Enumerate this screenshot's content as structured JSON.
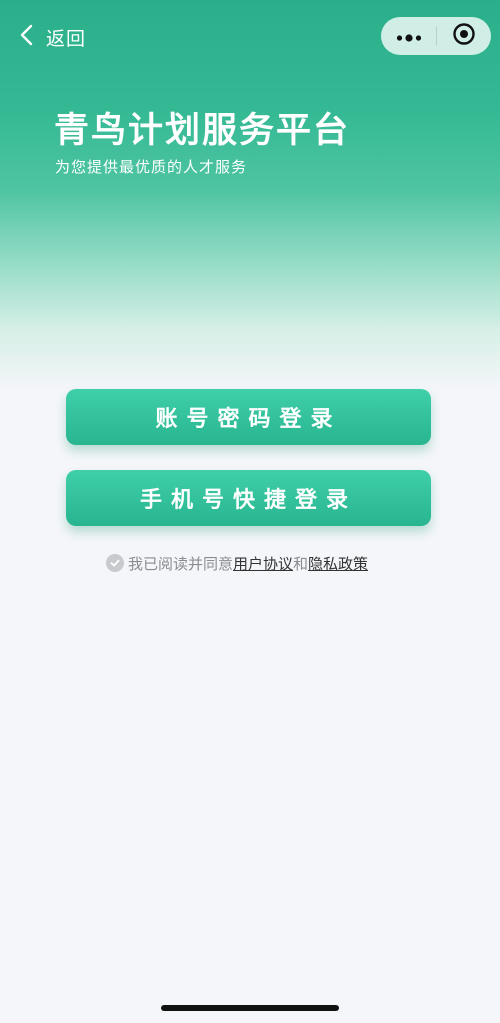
{
  "nav": {
    "back_label": "返回",
    "icons": {
      "back": "chevron-left-icon",
      "more": "more-dots-icon",
      "close": "target-circle-icon"
    }
  },
  "hero": {
    "title": "青鸟计划服务平台",
    "subtitle": "为您提供最优质的人才服务"
  },
  "buttons": {
    "account_login": "账号密码登录",
    "phone_login": "手机号快捷登录"
  },
  "agreement": {
    "prefix": "我已阅读并同意",
    "user_agreement": "用户协议",
    "conjunction": "和",
    "privacy_policy": "隐私政策",
    "checked": true
  },
  "colors": {
    "brand_green": "#2aaf8a",
    "button_top": "#3fcfa9",
    "button_bottom": "#28b58f",
    "background": "#f4f6f9"
  }
}
